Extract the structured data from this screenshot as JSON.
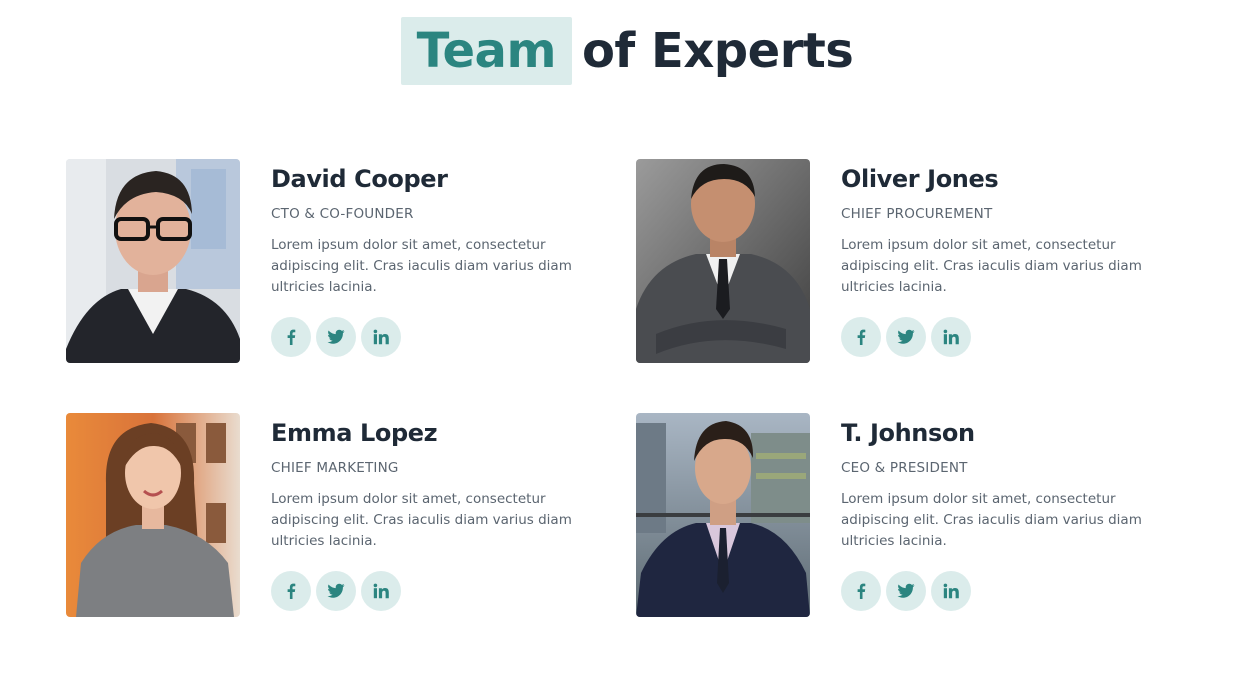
{
  "heading": {
    "highlight": "Team",
    "rest": "of Experts"
  },
  "colors": {
    "accent": "#2b8580",
    "accent_bg": "#dbeceb",
    "heading_text": "#1f2a37",
    "body_text": "#5b6570"
  },
  "team": [
    {
      "name": "David Cooper",
      "role": "CTO & CO-FOUNDER",
      "bio": "Lorem ipsum dolor sit amet, consectetur adipiscing elit. Cras iaculis diam varius diam ultricies lacinia.",
      "socials": [
        "facebook-icon",
        "twitter-icon",
        "linkedin-icon"
      ]
    },
    {
      "name": "Oliver Jones",
      "role": "CHIEF PROCUREMENT",
      "bio": "Lorem ipsum dolor sit amet, consectetur adipiscing elit. Cras iaculis diam varius diam ultricies lacinia.",
      "socials": [
        "facebook-icon",
        "twitter-icon",
        "linkedin-icon"
      ]
    },
    {
      "name": "Emma Lopez",
      "role": "CHIEF MARKETING",
      "bio": "Lorem ipsum dolor sit amet, consectetur adipiscing elit. Cras iaculis diam varius diam ultricies lacinia.",
      "socials": [
        "facebook-icon",
        "twitter-icon",
        "linkedin-icon"
      ]
    },
    {
      "name": "T. Johnson",
      "role": "CEO & PRESIDENT",
      "bio": "Lorem ipsum dolor sit amet, consectetur adipiscing elit. Cras iaculis diam varius diam ultricies lacinia.",
      "socials": [
        "facebook-icon",
        "twitter-icon",
        "linkedin-icon"
      ]
    }
  ]
}
